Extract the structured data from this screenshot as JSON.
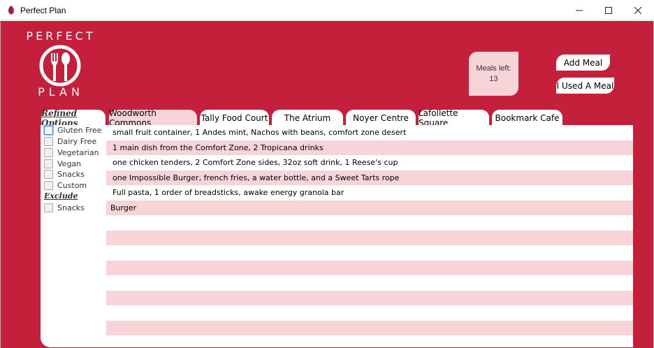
{
  "window": {
    "title": "Perfect Plan"
  },
  "logo": {
    "top": "PERFECT",
    "bottom": "PLAN"
  },
  "meals": {
    "label": "Meals left:",
    "count": "13"
  },
  "buttons": {
    "add_meal": "Add Meal",
    "used_meal": "I Used A Meal"
  },
  "tabs": [
    {
      "label": "Woodworth Commons",
      "active": true
    },
    {
      "label": "Tally Food Court",
      "active": false
    },
    {
      "label": "The Atrium",
      "active": false
    },
    {
      "label": "Noyer Centre",
      "active": false
    },
    {
      "label": "Lafollette Square",
      "active": false
    },
    {
      "label": "Bookmark Cafe",
      "active": false
    }
  ],
  "options": {
    "title": "Refined Options",
    "items": [
      "Gluten Free",
      "Dairy Free",
      "Vegetarian",
      "Vegan",
      "Snacks",
      "Custom"
    ],
    "exclude_title": "Exclude",
    "exclude_items": [
      "Snacks"
    ]
  },
  "meal_list": [
    "small fruit container, 1 Andes mint, Nachos with beans, comfort zone desert",
    "1 main dish from the Comfort Zone, 2 Tropicana drinks",
    "one chicken tenders, 2 Comfort Zone sides, 32oz soft drink, 1 Reese's cup",
    "one Impossible Burger, french fries, a water bottle, and a Sweet Tarts rope",
    "Full pasta, 1 order of breadsticks, awake energy granola bar",
    "Burger",
    "",
    "",
    "",
    "",
    "",
    "",
    "",
    "",
    ""
  ],
  "colors": {
    "brand_red": "#c41f3b",
    "row_alt": "#f7d4d8"
  }
}
